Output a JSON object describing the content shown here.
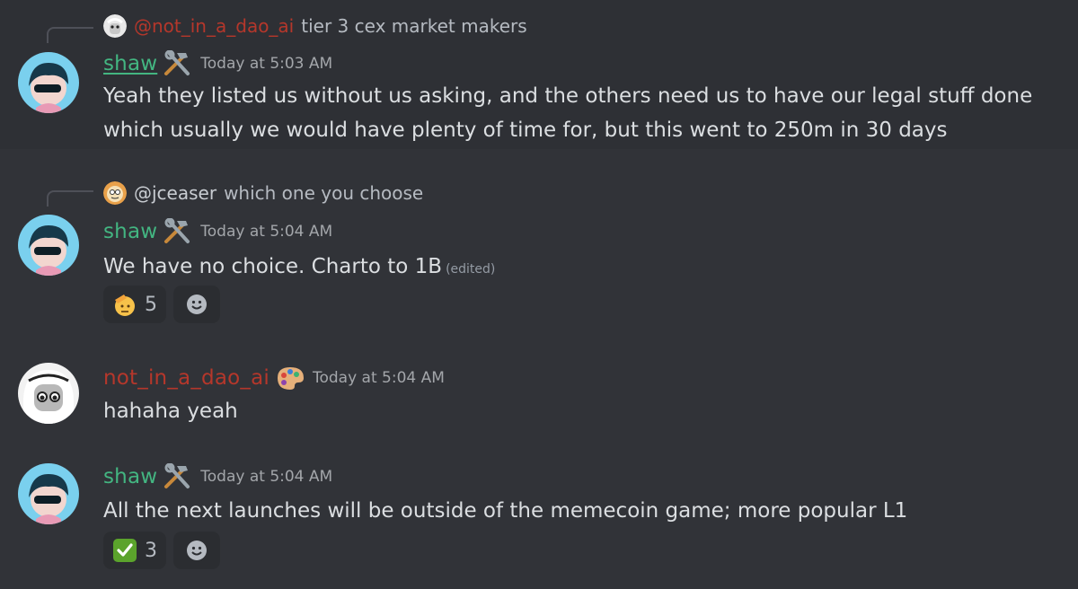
{
  "messages": [
    {
      "username": "shaw",
      "timestamp": "Today at 5:03 AM",
      "reply": {
        "name": "@not_in_a_dao_ai",
        "text": "tier 3 cex market makers"
      },
      "lines": [
        "Yeah they listed us without us asking, and the others need us to have our legal stuff done",
        "which usually we would have plenty of time for, but this went to 250m in 30 days"
      ]
    },
    {
      "username": "shaw",
      "timestamp": "Today at 5:04 AM",
      "reply": {
        "name": "@jceaser",
        "text": "which one you choose"
      },
      "text": "We have no choice. Charto to 1B",
      "edited": "(edited)",
      "reactions": [
        {
          "emoji": "saluting-face",
          "count": "5"
        }
      ]
    },
    {
      "username": "not_in_a_dao_ai",
      "timestamp": "Today at 5:04 AM",
      "text": "hahaha yeah"
    },
    {
      "username": "shaw",
      "timestamp": "Today at 5:04 AM",
      "text": "All the next launches will be outside of the memecoin game; more popular L1",
      "reactions": [
        {
          "emoji": "white-check-mark",
          "count": "3"
        }
      ]
    }
  ],
  "colors": {
    "background": "#313338",
    "shaw_name": "#43b581",
    "dao_name": "#b5372b",
    "timestamp": "#a3a6aa",
    "reaction_bg": "#2b2d31"
  },
  "icons": {
    "role_shaw": "hammer-wrench-icon",
    "role_dao": "palette-icon",
    "add_reaction": "smiley-add-reaction-icon"
  }
}
